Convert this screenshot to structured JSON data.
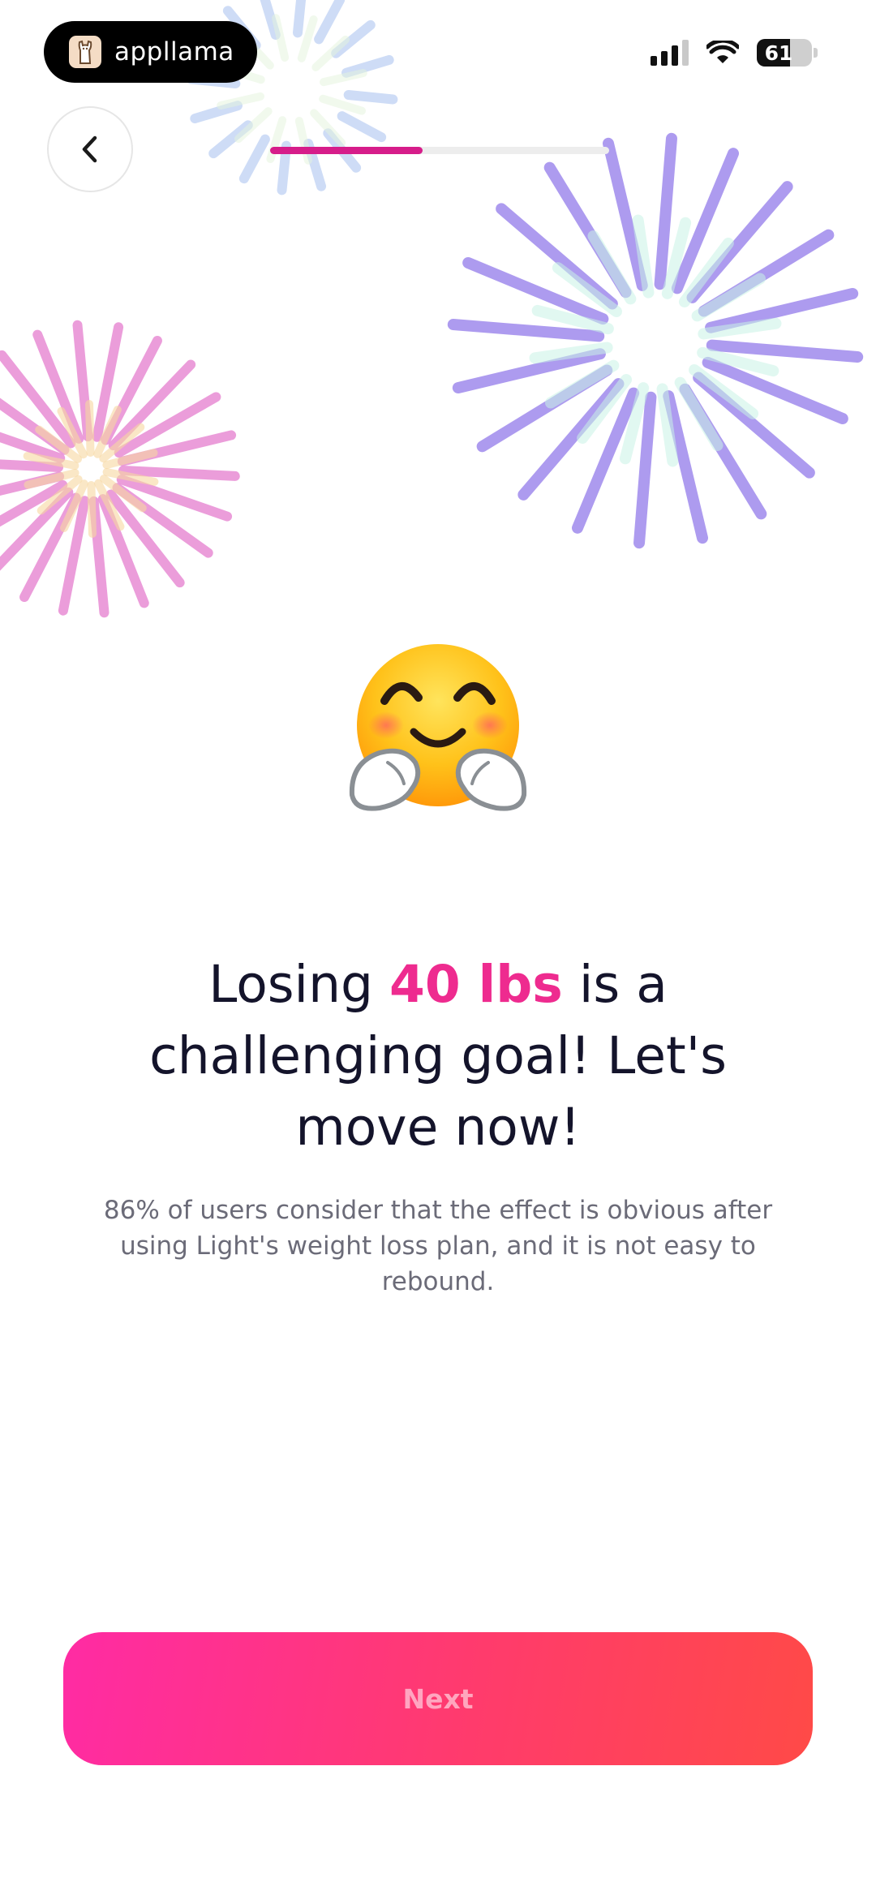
{
  "status_bar": {
    "app_name": "appllama",
    "battery_percent": "61",
    "battery_level": 0.61
  },
  "navigation": {
    "back_icon": "chevron-left-icon",
    "progress": 0.45
  },
  "content": {
    "emoji": "smiling-face-with-open-hands",
    "headline": {
      "prefix": "Losing ",
      "highlight": "40 lbs",
      "suffix": " is a challenging goal! Let's move now!"
    },
    "subtext": "86% of users consider that the effect is obvious after using Light's weight loss plan, and it is not easy to rebound."
  },
  "footer": {
    "next_label": "Next"
  },
  "colors": {
    "accent": "#ee2b8f",
    "progress_fill": "#d61d8a",
    "button_gradient_start": "#ff2ba4",
    "button_gradient_end": "#ff4a47",
    "firework_purple": "#a996ee",
    "firework_pink": "#e992d6",
    "firework_blue": "#b9cdf2"
  }
}
